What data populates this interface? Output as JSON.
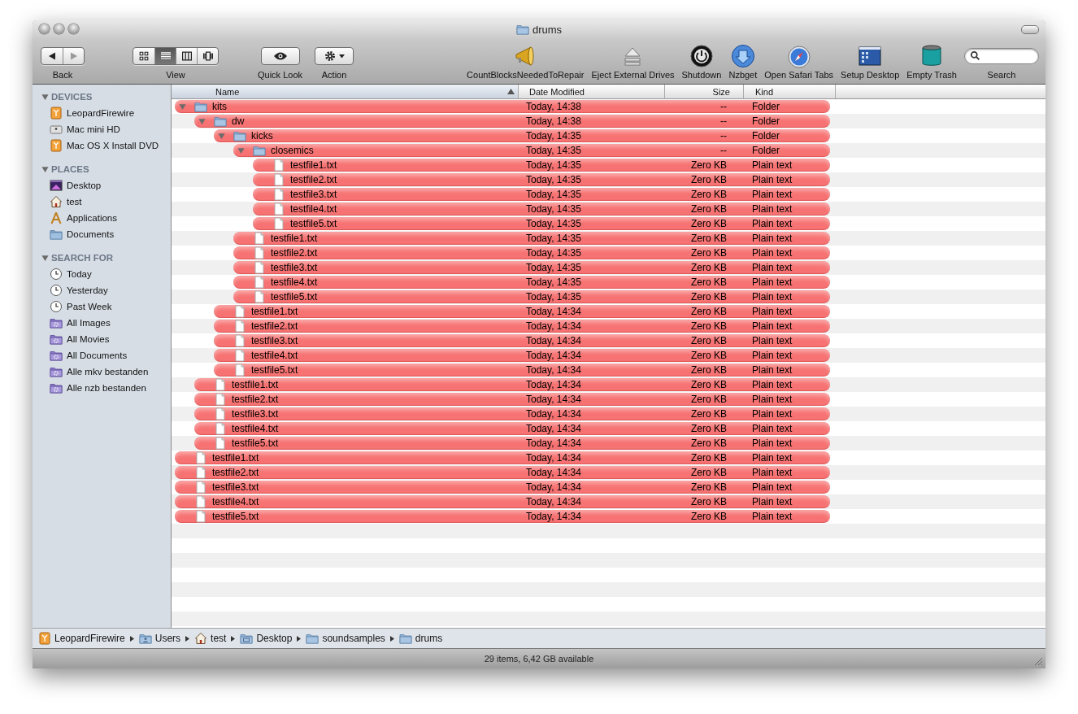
{
  "window": {
    "title": "drums"
  },
  "toolbar": {
    "items": [
      {
        "kind": "nav",
        "label": "Back"
      },
      {
        "kind": "view",
        "label": "View",
        "modes": [
          {
            "selected": false
          },
          {
            "selected": true
          },
          {
            "selected": false
          },
          {
            "selected": false
          }
        ]
      },
      {
        "kind": "quicklook",
        "label": "Quick Look"
      },
      {
        "kind": "action",
        "label": "Action"
      },
      {
        "kind": "megaphone",
        "label": "CountBlocksNeededToRepair"
      },
      {
        "kind": "eject",
        "label": "Eject External Drives"
      },
      {
        "kind": "power",
        "label": "Shutdown"
      },
      {
        "kind": "download",
        "label": "Nzbget"
      },
      {
        "kind": "compass",
        "label": "Open Safari Tabs"
      },
      {
        "kind": "screen",
        "label": "Setup Desktop"
      },
      {
        "kind": "trash",
        "label": "Empty Trash"
      },
      {
        "kind": "search",
        "label": "Search"
      }
    ]
  },
  "sidebar": {
    "sections": [
      {
        "title": "DEVICES",
        "expanded": true,
        "items": [
          {
            "kind": "firewire",
            "label": "LeopardFirewire"
          },
          {
            "kind": "harddrive",
            "label": "Mac mini HD"
          },
          {
            "kind": "firewire",
            "label": "Mac OS X Install DVD"
          }
        ]
      },
      {
        "title": "PLACES",
        "expanded": true,
        "items": [
          {
            "kind": "desktop",
            "label": "Desktop"
          },
          {
            "kind": "home",
            "label": "test"
          },
          {
            "kind": "applications",
            "label": "Applications"
          },
          {
            "kind": "documents",
            "label": "Documents"
          }
        ]
      },
      {
        "title": "SEARCH FOR",
        "expanded": true,
        "items": [
          {
            "kind": "clock",
            "label": "Today"
          },
          {
            "kind": "clock",
            "label": "Yesterday"
          },
          {
            "kind": "clock",
            "label": "Past Week"
          },
          {
            "kind": "smart",
            "label": "All Images"
          },
          {
            "kind": "smart",
            "label": "All Movies"
          },
          {
            "kind": "smart",
            "label": "All Documents"
          },
          {
            "kind": "smart",
            "label": "Alle mkv bestanden"
          },
          {
            "kind": "smart",
            "label": "Alle nzb bestanden"
          }
        ]
      }
    ]
  },
  "list": {
    "columns": [
      {
        "label": "Name",
        "sorted": true
      },
      {
        "label": "Date Modified",
        "sorted": false
      },
      {
        "label": "Size",
        "sorted": false
      },
      {
        "label": "Kind",
        "sorted": false
      }
    ],
    "rows": [
      {
        "kind": "folder",
        "name": "kits",
        "date": "Today, 14:38",
        "size": "--",
        "file_kind": "Folder",
        "color": "#f77373",
        "expanded": true,
        "children": [
          {
            "kind": "folder",
            "name": "dw",
            "date": "Today, 14:38",
            "size": "--",
            "file_kind": "Folder",
            "color": "#f77373",
            "expanded": true,
            "children": [
              {
                "kind": "folder",
                "name": "kicks",
                "date": "Today, 14:35",
                "size": "--",
                "file_kind": "Folder",
                "color": "#f77373",
                "expanded": true,
                "children": [
                  {
                    "kind": "folder",
                    "name": "closemics",
                    "date": "Today, 14:35",
                    "size": "--",
                    "file_kind": "Folder",
                    "color": "#f77373",
                    "expanded": true,
                    "children": [
                      {
                        "kind": "file",
                        "name": "testfile1.txt",
                        "date": "Today, 14:35",
                        "size": "Zero KB",
                        "file_kind": "Plain text",
                        "color": "#f77373"
                      },
                      {
                        "kind": "file",
                        "name": "testfile2.txt",
                        "date": "Today, 14:35",
                        "size": "Zero KB",
                        "file_kind": "Plain text",
                        "color": "#f77373"
                      },
                      {
                        "kind": "file",
                        "name": "testfile3.txt",
                        "date": "Today, 14:35",
                        "size": "Zero KB",
                        "file_kind": "Plain text",
                        "color": "#f77373"
                      },
                      {
                        "kind": "file",
                        "name": "testfile4.txt",
                        "date": "Today, 14:35",
                        "size": "Zero KB",
                        "file_kind": "Plain text",
                        "color": "#f77373"
                      },
                      {
                        "kind": "file",
                        "name": "testfile5.txt",
                        "date": "Today, 14:35",
                        "size": "Zero KB",
                        "file_kind": "Plain text",
                        "color": "#f77373"
                      }
                    ]
                  },
                  {
                    "kind": "file",
                    "name": "testfile1.txt",
                    "date": "Today, 14:35",
                    "size": "Zero KB",
                    "file_kind": "Plain text",
                    "color": "#f77373"
                  },
                  {
                    "kind": "file",
                    "name": "testfile2.txt",
                    "date": "Today, 14:35",
                    "size": "Zero KB",
                    "file_kind": "Plain text",
                    "color": "#f77373"
                  },
                  {
                    "kind": "file",
                    "name": "testfile3.txt",
                    "date": "Today, 14:35",
                    "size": "Zero KB",
                    "file_kind": "Plain text",
                    "color": "#f77373"
                  },
                  {
                    "kind": "file",
                    "name": "testfile4.txt",
                    "date": "Today, 14:35",
                    "size": "Zero KB",
                    "file_kind": "Plain text",
                    "color": "#f77373"
                  },
                  {
                    "kind": "file",
                    "name": "testfile5.txt",
                    "date": "Today, 14:35",
                    "size": "Zero KB",
                    "file_kind": "Plain text",
                    "color": "#f77373"
                  }
                ]
              },
              {
                "kind": "file",
                "name": "testfile1.txt",
                "date": "Today, 14:34",
                "size": "Zero KB",
                "file_kind": "Plain text",
                "color": "#f77373"
              },
              {
                "kind": "file",
                "name": "testfile2.txt",
                "date": "Today, 14:34",
                "size": "Zero KB",
                "file_kind": "Plain text",
                "color": "#f77373"
              },
              {
                "kind": "file",
                "name": "testfile3.txt",
                "date": "Today, 14:34",
                "size": "Zero KB",
                "file_kind": "Plain text",
                "color": "#f77373"
              },
              {
                "kind": "file",
                "name": "testfile4.txt",
                "date": "Today, 14:34",
                "size": "Zero KB",
                "file_kind": "Plain text",
                "color": "#f77373"
              },
              {
                "kind": "file",
                "name": "testfile5.txt",
                "date": "Today, 14:34",
                "size": "Zero KB",
                "file_kind": "Plain text",
                "color": "#f77373"
              }
            ]
          },
          {
            "kind": "file",
            "name": "testfile1.txt",
            "date": "Today, 14:34",
            "size": "Zero KB",
            "file_kind": "Plain text",
            "color": "#f77373"
          },
          {
            "kind": "file",
            "name": "testfile2.txt",
            "date": "Today, 14:34",
            "size": "Zero KB",
            "file_kind": "Plain text",
            "color": "#f77373"
          },
          {
            "kind": "file",
            "name": "testfile3.txt",
            "date": "Today, 14:34",
            "size": "Zero KB",
            "file_kind": "Plain text",
            "color": "#f77373"
          },
          {
            "kind": "file",
            "name": "testfile4.txt",
            "date": "Today, 14:34",
            "size": "Zero KB",
            "file_kind": "Plain text",
            "color": "#f77373"
          },
          {
            "kind": "file",
            "name": "testfile5.txt",
            "date": "Today, 14:34",
            "size": "Zero KB",
            "file_kind": "Plain text",
            "color": "#f77373"
          }
        ]
      },
      {
        "kind": "file",
        "name": "testfile1.txt",
        "date": "Today, 14:34",
        "size": "Zero KB",
        "file_kind": "Plain text",
        "color": "#f77373"
      },
      {
        "kind": "file",
        "name": "testfile2.txt",
        "date": "Today, 14:34",
        "size": "Zero KB",
        "file_kind": "Plain text",
        "color": "#f77373"
      },
      {
        "kind": "file",
        "name": "testfile3.txt",
        "date": "Today, 14:34",
        "size": "Zero KB",
        "file_kind": "Plain text",
        "color": "#f77373"
      },
      {
        "kind": "file",
        "name": "testfile4.txt",
        "date": "Today, 14:34",
        "size": "Zero KB",
        "file_kind": "Plain text",
        "color": "#f77373"
      },
      {
        "kind": "file",
        "name": "testfile5.txt",
        "date": "Today, 14:34",
        "size": "Zero KB",
        "file_kind": "Plain text",
        "color": "#f77373"
      }
    ]
  },
  "path_bar": [
    {
      "kind": "firewire",
      "label": "LeopardFirewire"
    },
    {
      "kind": "users",
      "label": "Users"
    },
    {
      "kind": "home",
      "label": "test"
    },
    {
      "kind": "desktopfolder",
      "label": "Desktop"
    },
    {
      "kind": "folder",
      "label": "soundsamples"
    },
    {
      "kind": "folder",
      "label": "drums"
    }
  ],
  "status_bar": "29 items, 6,42 GB available"
}
